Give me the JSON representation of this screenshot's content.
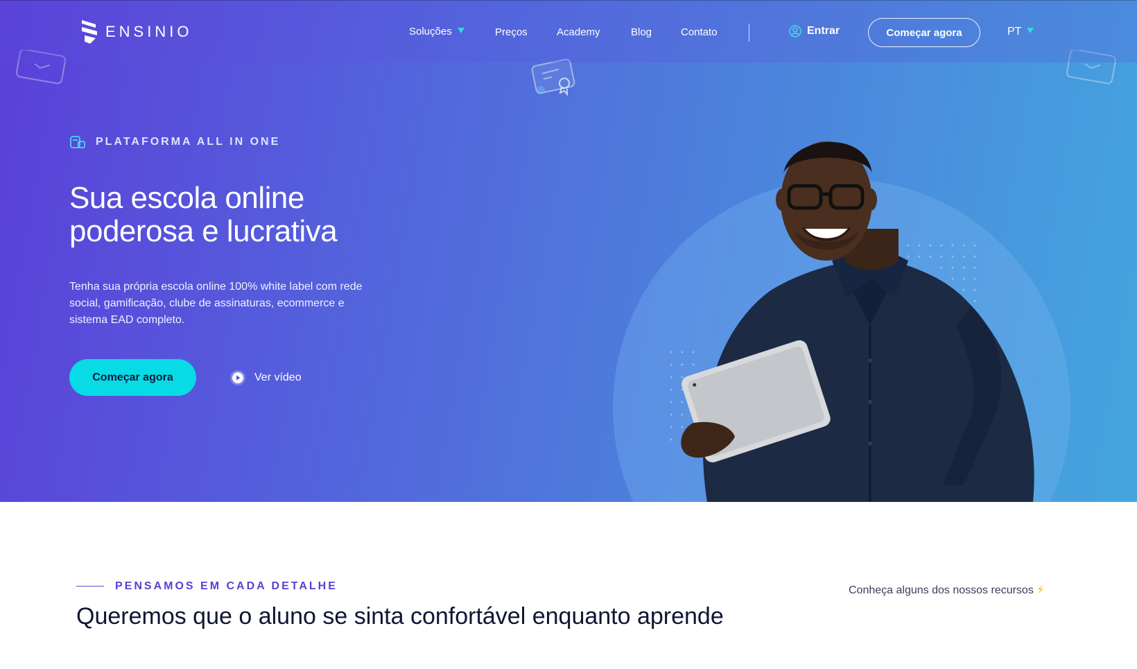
{
  "header": {
    "logo_text": "ENSINIO",
    "nav": [
      {
        "label": "Soluções",
        "has_dropdown": true
      },
      {
        "label": "Preços"
      },
      {
        "label": "Academy"
      },
      {
        "label": "Blog"
      },
      {
        "label": "Contato"
      }
    ],
    "login_label": "Entrar",
    "cta_label": "Começar agora",
    "language": "PT"
  },
  "hero": {
    "eyebrow": "PLATAFORMA ALL IN ONE",
    "title_line1": "Sua escola online",
    "title_line2": "poderosa e lucrativa",
    "subtitle": "Tenha sua própria escola online 100% white label com rede social, gamificação, clube de assinaturas, ecommerce e sistema EAD completo.",
    "cta_label": "Começar agora",
    "video_label": "Ver vídeo"
  },
  "section": {
    "eyebrow": "PENSAMOS EM CADA DETALHE",
    "title": "Queremos que o aluno se sinta confortável enquanto aprende",
    "link_label": "Conheça alguns dos nossos recursos",
    "link_emoji": "⚡"
  },
  "colors": {
    "accent_cyan": "#08dbe6",
    "gradient_start": "#5b3fd9",
    "gradient_end": "#44a6de",
    "section_eyebrow": "#5b3fd0"
  },
  "icons": [
    "logo-mark-icon",
    "caret-down-icon",
    "user-icon",
    "certificate-icon",
    "platform-icon",
    "play-icon",
    "bolt-icon"
  ]
}
